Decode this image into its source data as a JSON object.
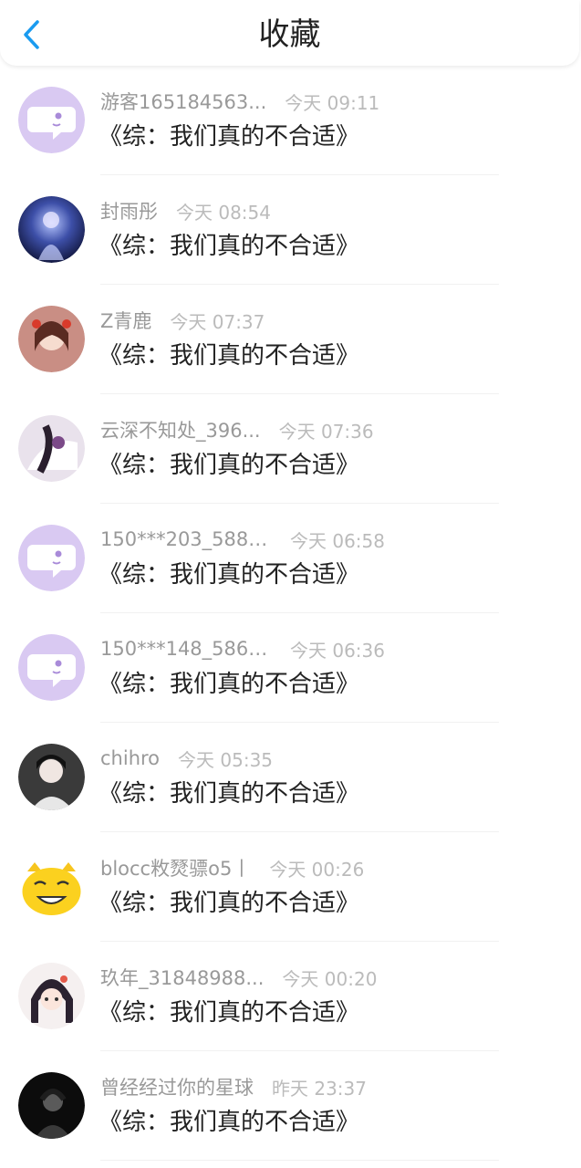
{
  "header": {
    "title": "收藏",
    "back_icon": "chevron-left-icon",
    "accent_color": "#1a9bf0"
  },
  "items": [
    {
      "user": "游客165184563...",
      "time": "今天 09:11",
      "book": "《综：我们真的不合适》",
      "avatar": "default-chat-avatar"
    },
    {
      "user": "封雨彤",
      "time": "今天 08:54",
      "book": "《综：我们真的不合适》",
      "avatar": "photo-avatar"
    },
    {
      "user": "Z青鹿",
      "time": "今天 07:37",
      "book": "《综：我们真的不合适》",
      "avatar": "photo-avatar"
    },
    {
      "user": "云深不知处_396...",
      "time": "今天 07:36",
      "book": "《综：我们真的不合适》",
      "avatar": "photo-avatar"
    },
    {
      "user": "150***203_5887...",
      "time": "今天 06:58",
      "book": "《综：我们真的不合适》",
      "avatar": "default-chat-avatar"
    },
    {
      "user": "150***148_5861...",
      "time": "今天 06:36",
      "book": "《综：我们真的不合适》",
      "avatar": "default-chat-avatar"
    },
    {
      "user": "chihro",
      "time": "今天 05:35",
      "book": "《综：我们真的不合适》",
      "avatar": "photo-avatar"
    },
    {
      "user": "blocc敉燹骠o5丨",
      "time": "今天 00:26",
      "book": "《综：我们真的不合适》",
      "avatar": "cat-emoji-avatar"
    },
    {
      "user": "玖年_31848988...",
      "time": "今天 00:20",
      "book": "《综：我们真的不合适》",
      "avatar": "photo-avatar"
    },
    {
      "user": "曾经经过你的星球",
      "time": "昨天 23:37",
      "book": "《综：我们真的不合适》",
      "avatar": "photo-avatar"
    }
  ]
}
